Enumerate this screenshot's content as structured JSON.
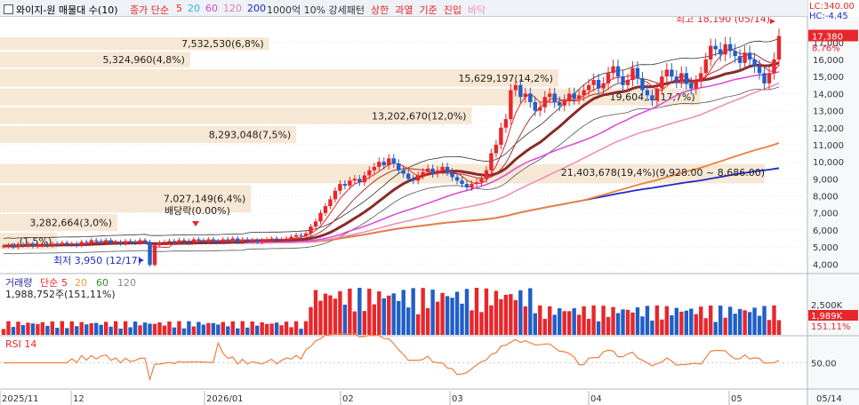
{
  "toolbar": {
    "title": "와이지-원 매물대 수(10)",
    "ma_label": "종가 단순",
    "ma_periods": [
      "5",
      "20",
      "60",
      "120",
      "200"
    ],
    "ma_colors": [
      "#e8262b",
      "#24b4f0",
      "#d946d9",
      "#e87ea8",
      "#1e2bc8"
    ],
    "options": [
      "1000억 10% 강세패턴",
      "상한",
      "과열",
      "기준",
      "진입",
      "바닥"
    ],
    "option_colors": [
      "#333333",
      "#e8262b",
      "#e8262b",
      "#e8262b",
      "#e8262b",
      "#f08fd0"
    ]
  },
  "price_panel": {
    "readout_lc": "LC:340.00",
    "readout_hc": "HC:-4.45",
    "last_price": "17,380",
    "last_change": "8.76%",
    "high_label": "최고 18,190 (05/14)",
    "low_label": "최저 3,950 (12/17)",
    "dividend_label": "배당락(0.00%)",
    "mid_label": "21,403,678(19,4%)(9,928.00 ~ 8,686.00)",
    "volume_profile": [
      {
        "label": "7,532,530(6,8%)",
        "volume": 7532530,
        "pct": 6.8,
        "price_lo": 16500,
        "price_hi": 17350
      },
      {
        "label": "5,324,960(4,8%)",
        "volume": 5324960,
        "pct": 4.8,
        "price_lo": 15480,
        "price_hi": 16500
      },
      {
        "label": "15,629,197(14,2%)",
        "volume": 15629197,
        "pct": 14.2,
        "price_lo": 14350,
        "price_hi": 15480
      },
      {
        "label": "19,604,...(17,7%)",
        "volume": 19604000,
        "pct": 17.7,
        "price_lo": 13250,
        "price_hi": 14350
      },
      {
        "label": "13,202,670(12,0%)",
        "volume": 13202670,
        "pct": 12.0,
        "price_lo": 12150,
        "price_hi": 13250
      },
      {
        "label": "8,293,048(7,5%)",
        "volume": 8293048,
        "pct": 7.5,
        "price_lo": 11050,
        "price_hi": 12150
      },
      {
        "label": "",
        "volume": 21403678,
        "pct": 19.4,
        "price_lo": 8686,
        "price_hi": 9928
      },
      {
        "label": "7,027,149(6,4%)",
        "volume": 7027149,
        "pct": 6.4,
        "price_lo": 6980,
        "price_hi": 8686
      },
      {
        "label": "3,282,664(3,0%)",
        "volume": 3282664,
        "pct": 3.0,
        "price_lo": 5890,
        "price_hi": 6980
      },
      {
        "label": "...(1,5%)",
        "volume": 1600000,
        "pct": 1.5,
        "price_lo": 4790,
        "price_hi": 5890
      }
    ]
  },
  "volume_panel": {
    "legend": [
      "거래량",
      "단순",
      "5",
      "20",
      "60",
      "120"
    ],
    "legend_colors": [
      "#2a2a9a",
      "#e8262b",
      "#e8262b",
      "#e8a23c",
      "#2f8f2f",
      "#888888"
    ],
    "current_volume": "1,988,752주(151,11%)",
    "axis_tick": "2,500K",
    "last_value": "1,989K",
    "last_pct": "151.11%"
  },
  "rsi_panel": {
    "legend": "RSI 14",
    "axis_tick": "50.00"
  },
  "x_axis": {
    "labels": [
      "2025/11",
      "12",
      "2026/01",
      "02",
      "03",
      "04",
      "05",
      "05/14"
    ]
  },
  "chart_data": {
    "type": "candlestick",
    "title": "와이지-원 매물대 수(10)",
    "ylim": [
      3600,
      18500
    ],
    "yticks": [
      4000,
      5000,
      6000,
      7000,
      8000,
      9000,
      10000,
      11000,
      12000,
      13000,
      14000,
      15000,
      16000,
      17000
    ],
    "ytick_labels": [
      "4,000",
      "5,000",
      "6,000",
      "7,000",
      "8,000",
      "9,000",
      "10,000",
      "11,000",
      "12,000",
      "13,000",
      "14,000",
      "15,000",
      "16,000",
      "17,000"
    ],
    "close_approx": [
      5050,
      5100,
      5000,
      5150,
      5100,
      5200,
      5050,
      5100,
      5150,
      5100,
      5200,
      5150,
      5250,
      5150,
      5200,
      5100,
      5300,
      5250,
      5400,
      5350,
      5300,
      5400,
      5250,
      5300,
      5200,
      5350,
      5300,
      5250,
      5400,
      5300,
      3950,
      5100,
      5250,
      5300,
      5350,
      5300,
      5400,
      5350,
      5300,
      5450,
      5400,
      5350,
      5450,
      5350,
      5300,
      5450,
      5400,
      5500,
      5300,
      5450,
      5350,
      5400,
      5300,
      5400,
      5450,
      5500,
      5400,
      5450,
      5500,
      5600,
      5700,
      5650,
      5800,
      6200,
      6500,
      7000,
      7400,
      7800,
      8300,
      8700,
      8600,
      8900,
      9000,
      8800,
      9200,
      9500,
      9700,
      10000,
      9800,
      10200,
      9900,
      9500,
      9300,
      9000,
      8900,
      9200,
      9400,
      9600,
      9300,
      9500,
      9700,
      9400,
      9100,
      8900,
      8700,
      8500,
      8700,
      8800,
      9000,
      9500,
      10500,
      11000,
      12000,
      12500,
      14200,
      14500,
      13800,
      14000,
      13500,
      13000,
      13200,
      13800,
      14000,
      13500,
      13300,
      13600,
      14000,
      13700,
      13900,
      14200,
      14500,
      14800,
      14300,
      14600,
      15200,
      15600,
      15000,
      14500,
      14800,
      15500,
      14900,
      14200,
      13900,
      13600,
      14300,
      15000,
      15400,
      15000,
      14700,
      15200,
      14600,
      14300,
      14700,
      15200,
      16000,
      16800,
      16600,
      16300,
      16900,
      16500,
      16200,
      15800,
      16400,
      16000,
      15600,
      15200,
      14600,
      15200,
      16000,
      17380
    ],
    "series": [
      {
        "name": "5",
        "role": "ma"
      },
      {
        "name": "20",
        "role": "ma"
      },
      {
        "name": "60",
        "role": "ma"
      },
      {
        "name": "120",
        "role": "ma"
      },
      {
        "name": "200",
        "role": "ma"
      }
    ],
    "volume_axis_ticks": [
      "2,500K"
    ],
    "rsi_axis_ticks": [
      "50.00"
    ]
  }
}
